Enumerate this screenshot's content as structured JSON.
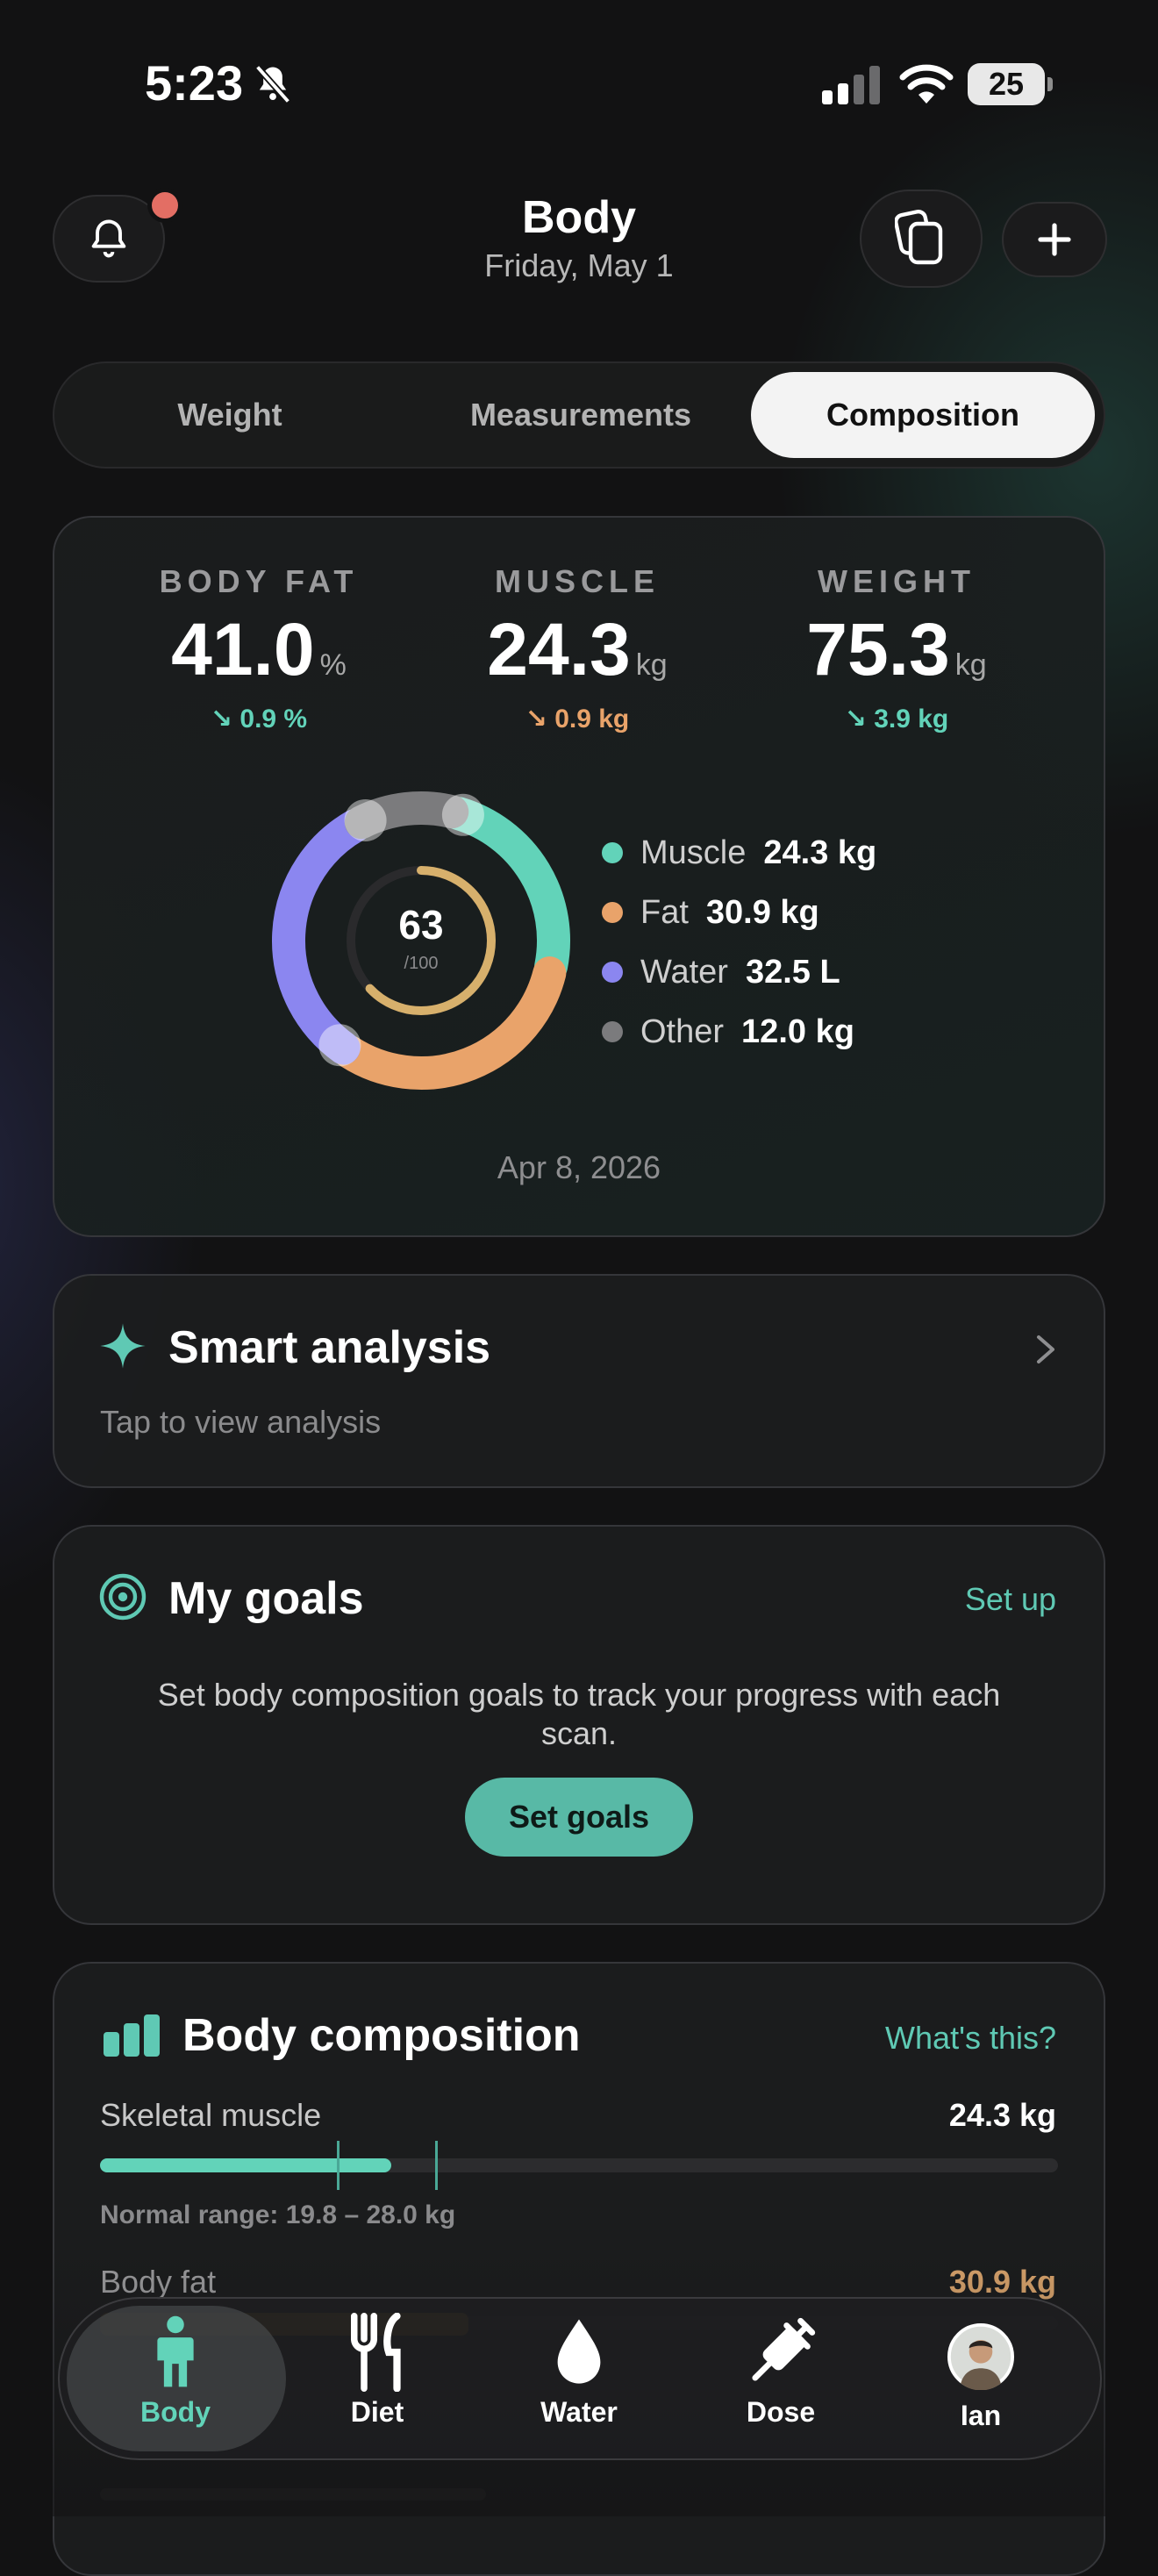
{
  "status_bar": {
    "time": "5:23",
    "battery": "25"
  },
  "header": {
    "title": "Body",
    "date": "Friday, May 1"
  },
  "segments": {
    "weight": "Weight",
    "measurements": "Measurements",
    "composition": "Composition",
    "active": "Composition"
  },
  "summary": {
    "metrics": [
      {
        "label": "BODY FAT",
        "value": "41.0",
        "unit": "%",
        "delta": "↘ 0.9 %",
        "delta_color": "#62d3b9"
      },
      {
        "label": "MUSCLE",
        "value": "24.3",
        "unit": "kg",
        "delta": "↘ 0.9 kg",
        "delta_color": "#e9a36a"
      },
      {
        "label": "WEIGHT",
        "value": "75.3",
        "unit": "kg",
        "delta": "↘ 3.9 kg",
        "delta_color": "#62d3b9"
      }
    ],
    "score": "63",
    "score_max": "/100",
    "score_fraction": 0.63,
    "legend": [
      {
        "name": "Muscle",
        "value": "24.3 kg",
        "color": "#62d3b9"
      },
      {
        "name": "Fat",
        "value": "30.9 kg",
        "color": "#e9a36a"
      },
      {
        "name": "Water",
        "value": "32.5 L",
        "color": "#8b86f0"
      },
      {
        "name": "Other",
        "value": "12.0 kg",
        "color": "#7b7b7d"
      }
    ],
    "scan_date": "Apr 8, 2026"
  },
  "smart_analysis": {
    "title": "Smart analysis",
    "subtitle": "Tap to view analysis"
  },
  "goals": {
    "title": "My goals",
    "action": "Set up",
    "description": "Set body composition goals to track your progress with each scan.",
    "button": "Set goals"
  },
  "body_composition": {
    "title": "Body composition",
    "help": "What's this?",
    "rows": [
      {
        "name": "Skeletal muscle",
        "value": "24.3 kg",
        "value_color": "#ffffff",
        "range": "Normal range: 19.8 – 28.0 kg"
      },
      {
        "name": "Body fat",
        "value": "30.9 kg",
        "value_color": "#d7a26b"
      }
    ]
  },
  "tabbar": {
    "body": "Body",
    "diet": "Diet",
    "water": "Water",
    "dose": "Dose",
    "profile": "Ian",
    "active": "Body",
    "active_color": "#62d3b9"
  }
}
